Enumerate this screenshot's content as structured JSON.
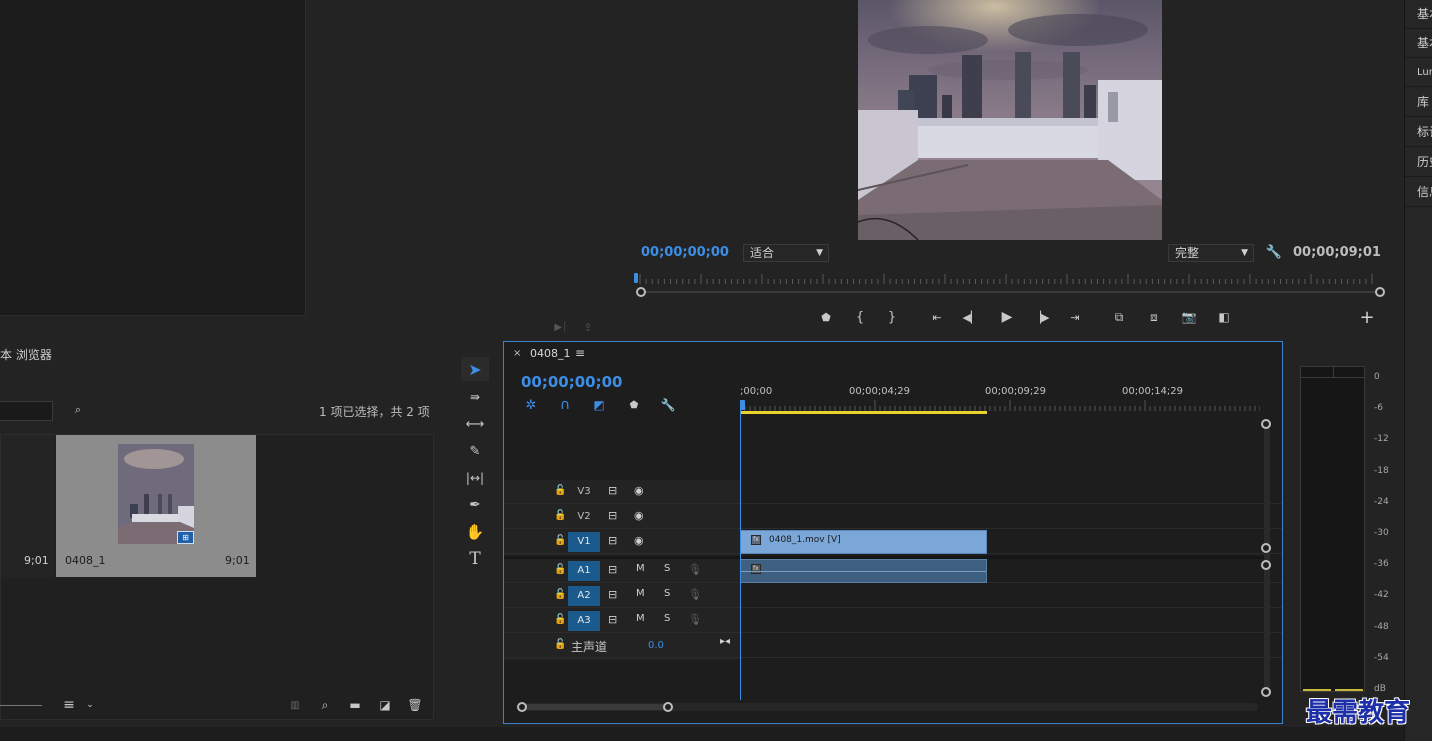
{
  "source": {
    "footer_icons": [
      "insert-icon",
      "export-frame-icon"
    ]
  },
  "program": {
    "timecode_current": "00;00;00;00",
    "fit_dropdown": "适合",
    "quality_dropdown": "完整",
    "timecode_duration": "00;00;09;01",
    "transport_icons": [
      "marker",
      "mark-in",
      "mark-out",
      "go-to-in",
      "step-back",
      "play",
      "step-forward",
      "go-to-out",
      "lift",
      "extract",
      "export-frame",
      "compare"
    ],
    "add_button": "+"
  },
  "side_tabs": [
    "基本",
    "基本",
    "Lumetri",
    "库",
    "标记",
    "历史",
    "信息"
  ],
  "project": {
    "title": "媒体浏览器",
    "title_visible": "本 浏览器",
    "selection_info": "1 项已选择，共 2 项",
    "items": [
      {
        "name": "",
        "duration": "9;01"
      },
      {
        "name": "0408_1",
        "duration": "9;01"
      }
    ]
  },
  "timeline": {
    "tab_title": "0408_1",
    "timecode": "00;00;00;00",
    "ruler": [
      ";00;00",
      "00;00;04;29",
      "00;00;09;29",
      "00;00;14;29"
    ],
    "video_tracks": [
      {
        "label": "V3"
      },
      {
        "label": "V2"
      },
      {
        "label": "V1"
      }
    ],
    "audio_tracks": [
      {
        "label": "A1",
        "m": "M",
        "s": "S"
      },
      {
        "label": "A2",
        "m": "M",
        "s": "S"
      },
      {
        "label": "A3",
        "m": "M",
        "s": "S"
      }
    ],
    "master": {
      "label": "主声道",
      "value": "0.0"
    },
    "video_clip": "0408_1.mov [V]",
    "fx_label": "fx"
  },
  "meter": {
    "scale": [
      "0",
      "-6",
      "-12",
      "-18",
      "-24",
      "-30",
      "-36",
      "-42",
      "-48",
      "-54",
      "dB"
    ]
  },
  "watermark": "最需教育",
  "colors": {
    "accent": "#3c8ee6",
    "clip_video": "#7ba7d8",
    "clip_audio": "#3f5f80",
    "work_area": "#e8d42a"
  }
}
